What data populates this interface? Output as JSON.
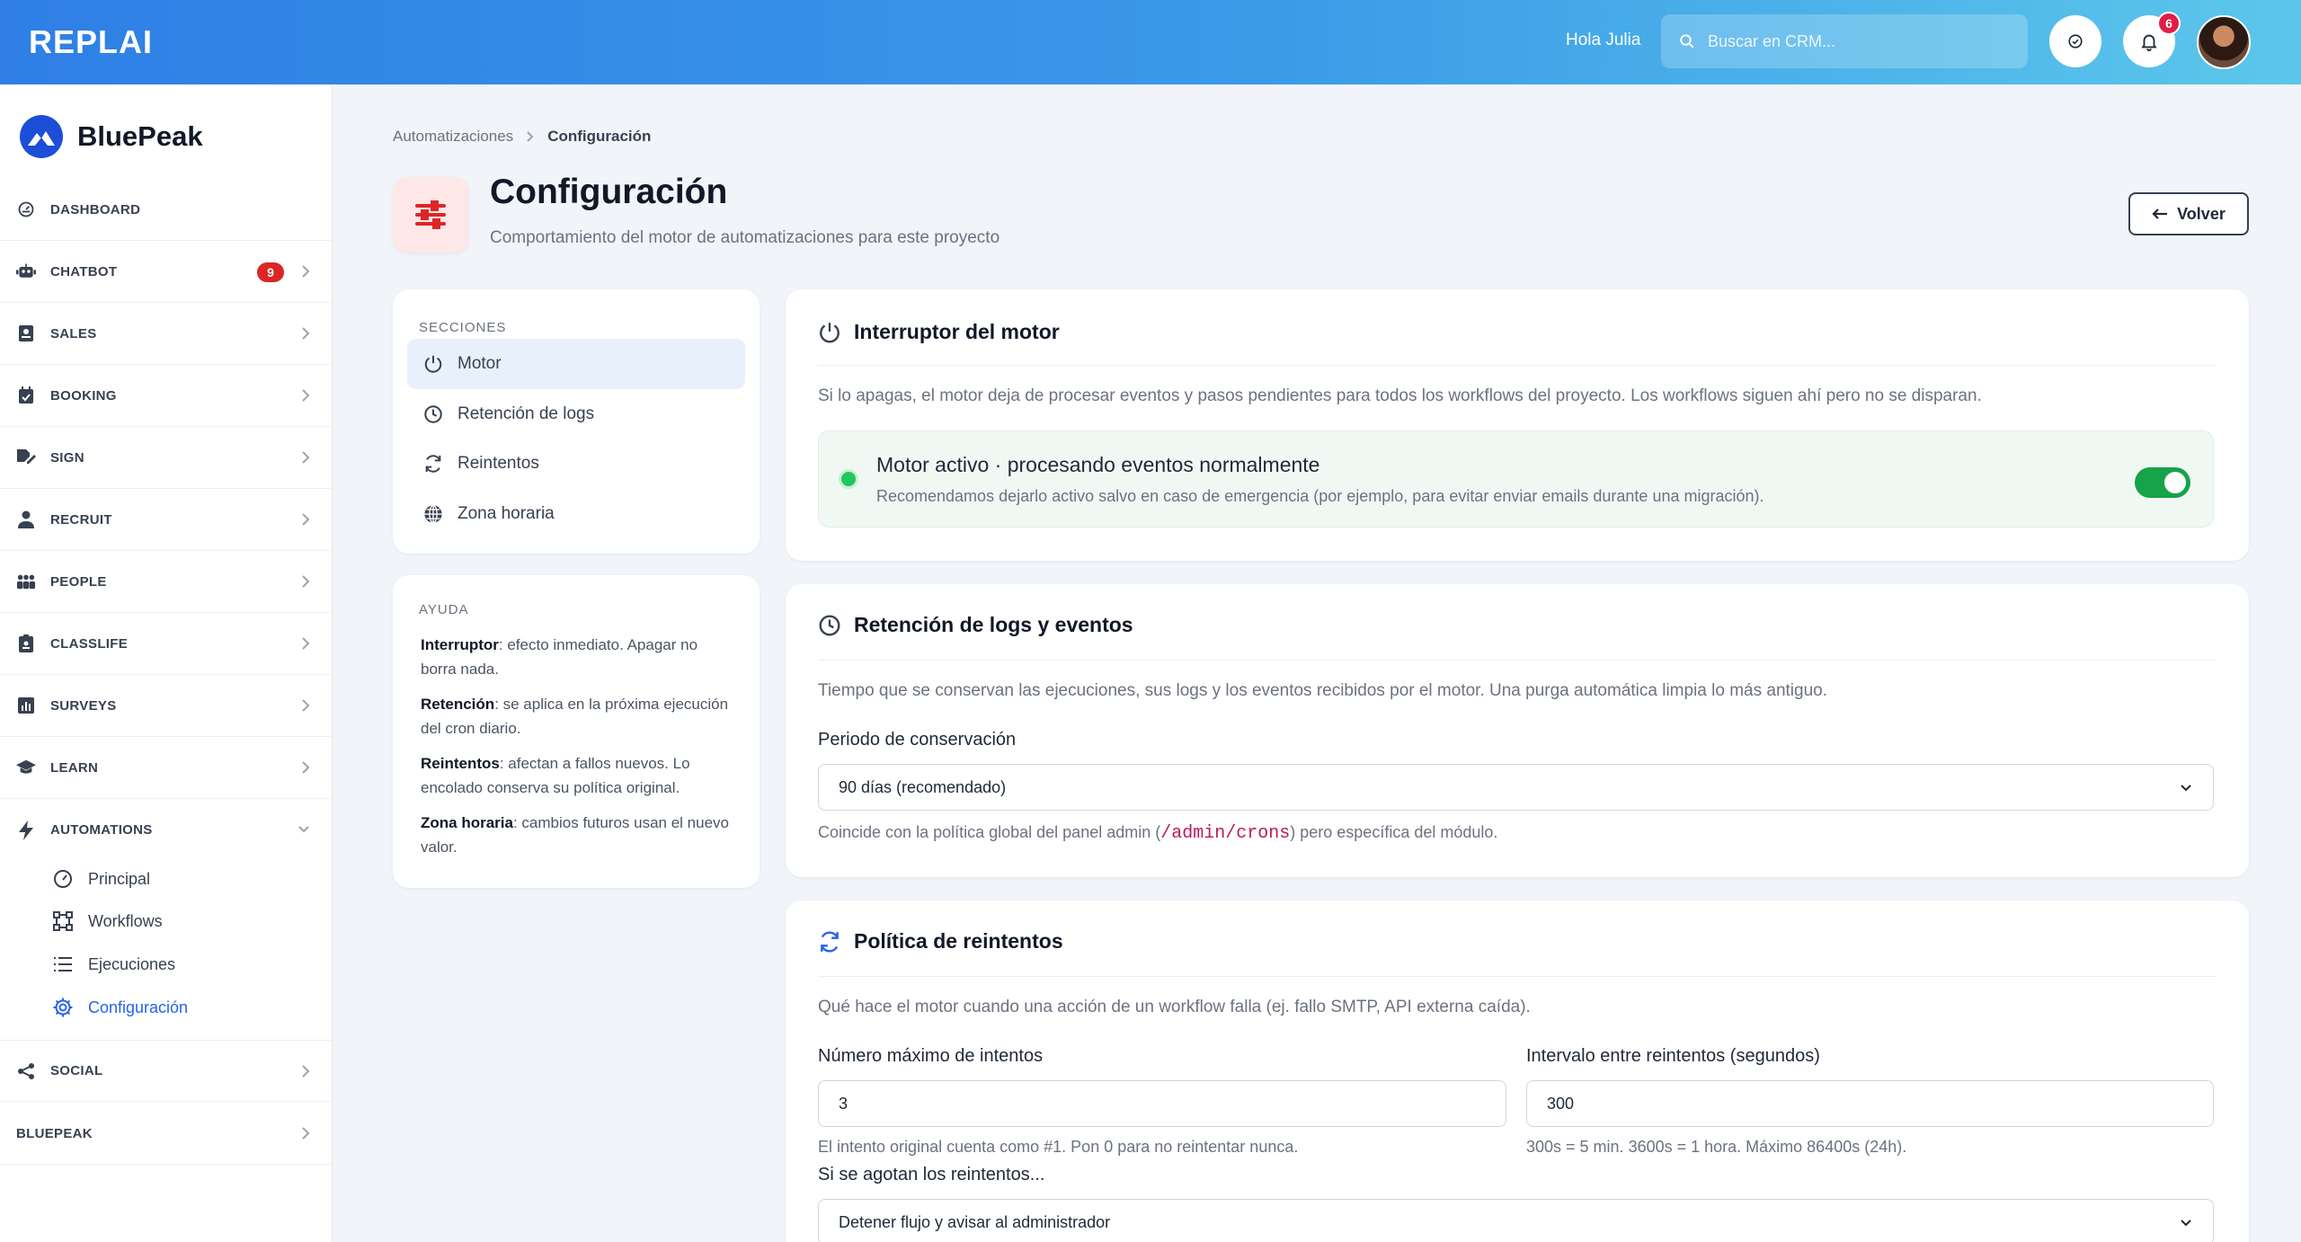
{
  "topbar": {
    "logo": "REPLAI",
    "greeting": "Hola Julia",
    "search_placeholder": "Buscar en CRM...",
    "notifications_count": "6",
    "icons": [
      "search-icon",
      "check-circle-icon",
      "bell-icon"
    ]
  },
  "sidebar": {
    "brand": "BluePeak",
    "items": [
      {
        "label": "DASHBOARD",
        "icon": "dashboard-icon"
      },
      {
        "label": "CHATBOT",
        "icon": "robot-icon",
        "badge": "9"
      },
      {
        "label": "SALES",
        "icon": "sales-icon"
      },
      {
        "label": "BOOKING",
        "icon": "calendar-check-icon"
      },
      {
        "label": "SIGN",
        "icon": "signature-icon"
      },
      {
        "label": "RECRUIT",
        "icon": "user-tie-icon"
      },
      {
        "label": "PEOPLE",
        "icon": "people-icon"
      },
      {
        "label": "CLASSLIFE",
        "icon": "id-badge-icon"
      },
      {
        "label": "SURVEYS",
        "icon": "bar-chart-icon"
      },
      {
        "label": "LEARN",
        "icon": "graduation-cap-icon"
      },
      {
        "label": "AUTOMATIONS",
        "icon": "bolt-icon"
      },
      {
        "label": "SOCIAL",
        "icon": "share-icon"
      },
      {
        "label": "BLUEPEAK",
        "icon": ""
      }
    ],
    "automation_sub": [
      {
        "label": "Principal",
        "icon": "gauge-icon"
      },
      {
        "label": "Workflows",
        "icon": "workflow-icon"
      },
      {
        "label": "Ejecuciones",
        "icon": "list-icon"
      },
      {
        "label": "Configuración",
        "icon": "gear-icon",
        "active": true
      }
    ]
  },
  "breadcrumb": {
    "parent": "Automatizaciones",
    "current": "Configuración"
  },
  "header": {
    "title": "Configuración",
    "subtitle": "Comportamiento del motor de automatizaciones para este proyecto",
    "back_label": "Volver"
  },
  "sections": {
    "title": "SECCIONES",
    "items": [
      {
        "label": "Motor",
        "icon": "power-icon",
        "active": true
      },
      {
        "label": "Retención de logs",
        "icon": "clock-icon"
      },
      {
        "label": "Reintentos",
        "icon": "refresh-icon"
      },
      {
        "label": "Zona horaria",
        "icon": "globe-icon"
      }
    ]
  },
  "help": {
    "title": "AYUDA",
    "items": [
      {
        "term": "Interruptor",
        "text": ": efecto inmediato. Apagar no borra nada."
      },
      {
        "term": "Retención",
        "text": ": se aplica en la próxima ejecución del cron diario."
      },
      {
        "term": "Reintentos",
        "text": ": afectan a fallos nuevos. Lo encolado conserva su política original."
      },
      {
        "term": "Zona horaria",
        "text": ": cambios futuros usan el nuevo valor."
      }
    ]
  },
  "engine": {
    "title": "Interruptor del motor",
    "description": "Si lo apagas, el motor deja de procesar eventos y pasos pendientes para todos los workflows del proyecto. Los workflows siguen ahí pero no se disparan.",
    "status_title": "Motor activo · procesando eventos normalmente",
    "status_sub": "Recomendamos dejarlo activo salvo en caso de emergencia (por ejemplo, para evitar enviar emails durante una migración).",
    "enabled": true,
    "status_color": "#22c55e"
  },
  "retention": {
    "title": "Retención de logs y eventos",
    "description": "Tiempo que se conservan las ejecuciones, sus logs y los eventos recibidos por el motor. Una purga automática limpia lo más antiguo.",
    "field_label": "Periodo de conservación",
    "selected": "90 días (recomendado)",
    "hint_before": "Coincide con la política global del panel admin (",
    "hint_code": "/admin/crons",
    "hint_after": ") pero específica del módulo."
  },
  "retries": {
    "title": "Política de reintentos",
    "description": "Qué hace el motor cuando una acción de un workflow falla (ej. fallo SMTP, API externa caída).",
    "max_label": "Número máximo de intentos",
    "max_value": "3",
    "max_hint": "El intento original cuenta como #1. Pon 0 para no reintentar nunca.",
    "interval_label": "Intervalo entre reintentos (segundos)",
    "interval_value": "300",
    "interval_hint": "300s = 5 min. 3600s = 1 hora. Máximo 86400s (24h).",
    "exhausted_label": "Si se agotan los reintentos...",
    "exhausted_selected": "Detener flujo y avisar al administrador"
  },
  "colors": {
    "accent": "#2563eb",
    "brand_gradient_start": "#2f7fe6",
    "brand_gradient_end": "#5cc7ea",
    "danger": "#dc2626",
    "success": "#16a34a"
  }
}
